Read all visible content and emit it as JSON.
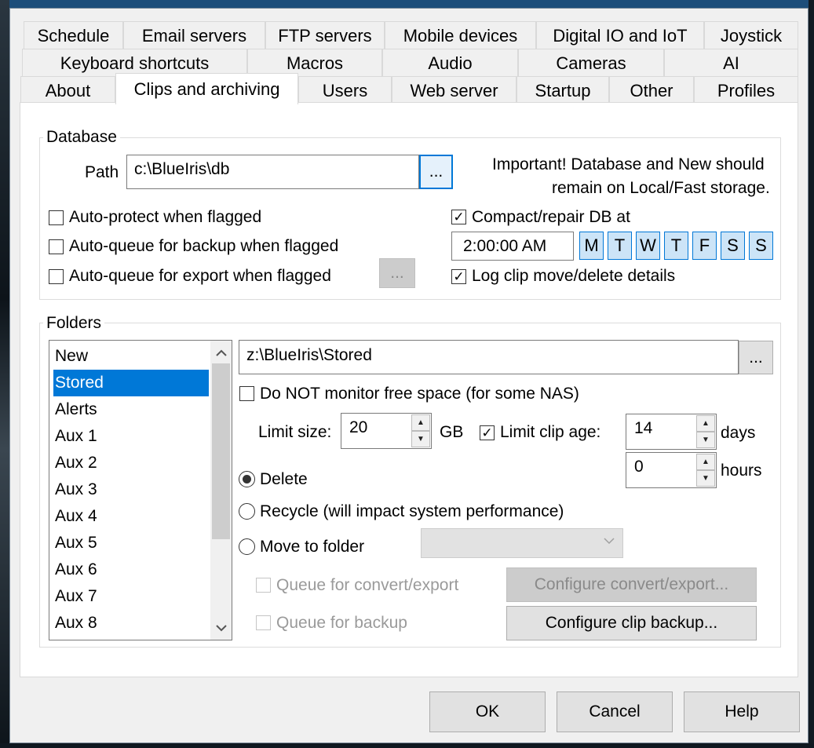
{
  "tabs_row1": [
    "Schedule",
    "Email servers",
    "FTP servers",
    "Mobile devices",
    "Digital IO and IoT",
    "Joystick"
  ],
  "tabs_row2": [
    "Keyboard shortcuts",
    "Macros",
    "Audio",
    "Cameras",
    "AI"
  ],
  "tabs_row3": [
    "About",
    "Clips and archiving",
    "Users",
    "Web server",
    "Startup",
    "Other",
    "Profiles"
  ],
  "database": {
    "title": "Database",
    "path_label": "Path",
    "path_value": "c:\\BlueIris\\db",
    "browse_label": "...",
    "note_line1": "Important! Database and New should",
    "note_line2": "remain on Local/Fast storage.",
    "auto_protect": "Auto-protect when flagged",
    "auto_backup": "Auto-queue for backup when flagged",
    "auto_export": "Auto-queue for export when flagged",
    "export_btn": "...",
    "compact_label": "Compact/repair DB at",
    "compact_checked": true,
    "compact_time": "2:00:00 AM",
    "days": [
      "M",
      "T",
      "W",
      "T",
      "F",
      "S",
      "S"
    ],
    "log_label": "Log clip move/delete details",
    "log_checked": true
  },
  "folders": {
    "title": "Folders",
    "items": [
      "New",
      "Stored",
      "Alerts",
      "Aux 1",
      "Aux 2",
      "Aux 3",
      "Aux 4",
      "Aux 5",
      "Aux 6",
      "Aux 7",
      "Aux 8"
    ],
    "selected": "Stored",
    "path_value": "z:\\BlueIris\\Stored",
    "browse_label": "...",
    "no_monitor_label": "Do NOT monitor free space (for some NAS)",
    "limit_size_label": "Limit size:",
    "limit_size_value": "20",
    "limit_size_unit": "GB",
    "limit_age_label": "Limit clip age:",
    "limit_age_checked": true,
    "age_days_value": "14",
    "age_days_unit": "days",
    "age_hours_value": "0",
    "age_hours_unit": "hours",
    "opt_delete": "Delete",
    "opt_recycle": "Recycle (will impact system performance)",
    "opt_move": "Move to folder",
    "queue_convert": "Queue for convert/export",
    "queue_backup": "Queue for backup",
    "configure_convert": "Configure convert/export...",
    "configure_backup": "Configure clip backup..."
  },
  "buttons": {
    "ok": "OK",
    "cancel": "Cancel",
    "help": "Help"
  },
  "icons": {
    "check": "check-icon",
    "scroll_up": "chevron-up-icon",
    "scroll_down": "chevron-down-icon",
    "dropdown": "chevron-down-icon"
  },
  "colors": {
    "accent": "#0078d7",
    "selected_bg": "#0078d7",
    "day_bg": "#cce4f7"
  }
}
